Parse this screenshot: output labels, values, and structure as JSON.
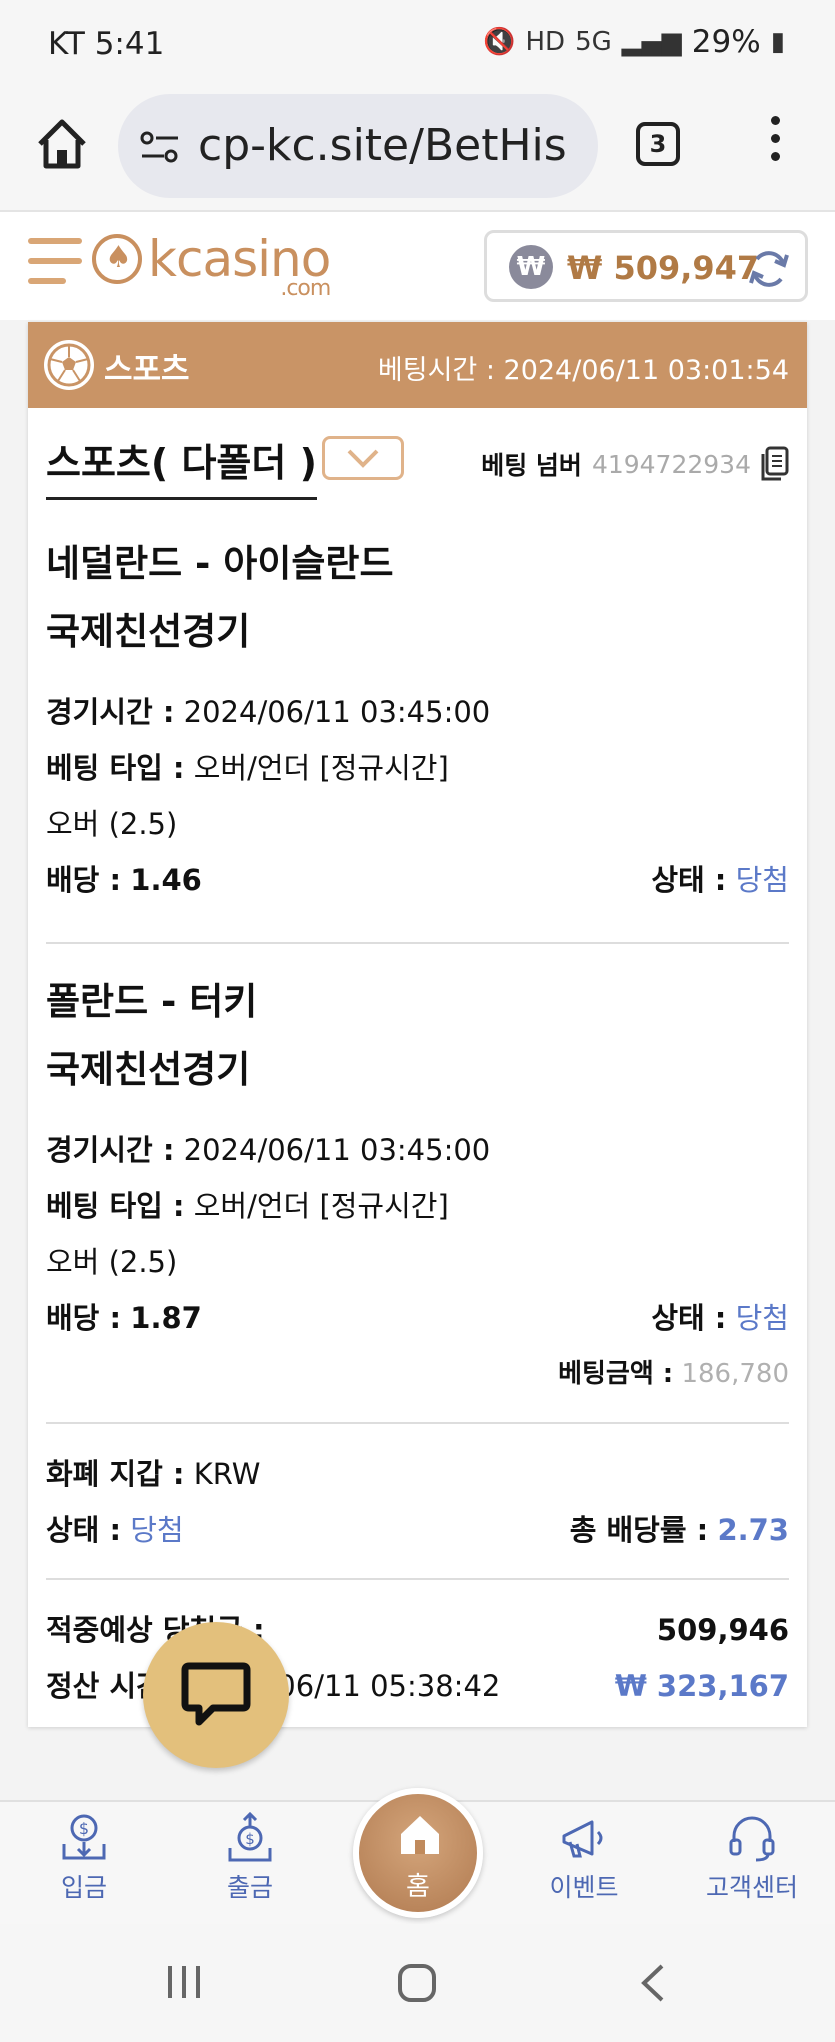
{
  "status": {
    "carrier_time": "KT 5:41",
    "battery": "29%"
  },
  "browser": {
    "url": "cp-kc.site/BetHis",
    "tab_count": "3"
  },
  "site": {
    "logo_text": "kcasino",
    "logo_sub": ".com",
    "balance": "₩ 509,947",
    "won_symbol": "₩"
  },
  "card": {
    "category": "스포츠",
    "bet_time": "베팅시간 : 2024/06/11 03:01:54",
    "bet_type_label": "스포츠( 다폴더 )",
    "bet_number_label": "베팅 넘버",
    "bet_number": "4194722934",
    "matches": [
      {
        "teams": "네덜란드 - 아이슬란드",
        "league": "국제친선경기",
        "time_label": "경기시간 :",
        "time": "2024/06/11 03:45:00",
        "type_label": "베팅 타입 :",
        "type": "오버/언더 [정규시간]",
        "pick": "오버 (2.5)",
        "odds_label": "배당 :",
        "odds": "1.46",
        "status_label": "상태 :",
        "status": "당첨"
      },
      {
        "teams": "폴란드 - 터키",
        "league": "국제친선경기",
        "time_label": "경기시간 :",
        "time": "2024/06/11 03:45:00",
        "type_label": "베팅 타입 :",
        "type": "오버/언더 [정규시간]",
        "pick": "오버 (2.5)",
        "odds_label": "배당 :",
        "odds": "1.87",
        "status_label": "상태 :",
        "status": "당첨"
      }
    ],
    "bet_amount_label": "베팅금액 :",
    "bet_amount": "186,780",
    "wallet_label": "화폐 지갑 :",
    "wallet": "KRW",
    "status_label": "상태 :",
    "status": "당첨",
    "total_odds_label": "총 배당률 :",
    "total_odds": "2.73",
    "expected_label": "적중예상 당첨금 :",
    "expected": "509,946",
    "settle_label": "정산 시간 :",
    "settle_time": "2024/06/11 05:38:42",
    "settle_amount": "₩ 323,167"
  },
  "nav": {
    "deposit": "입금",
    "withdraw": "출금",
    "home": "홈",
    "event": "이벤트",
    "support": "고객센터"
  },
  "colors": {
    "brand": "#c99466",
    "accent_blue": "#5b79c8",
    "chat": "#e3c07c"
  }
}
